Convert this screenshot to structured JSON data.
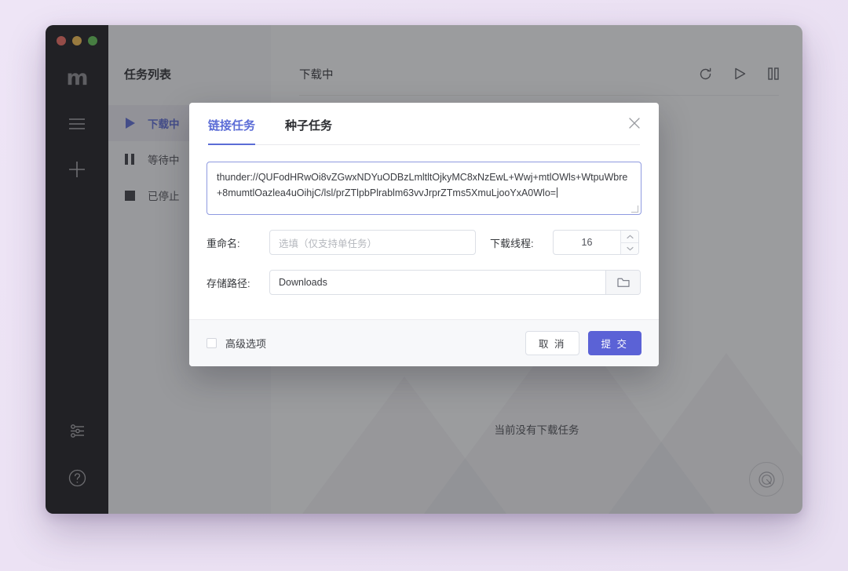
{
  "window": {
    "traffic_lights": [
      "close",
      "minimize",
      "maximize"
    ],
    "logo": "m"
  },
  "rail": {
    "items": [
      {
        "name": "menu",
        "icon": "hamburger-menu-icon"
      },
      {
        "name": "add",
        "icon": "plus-icon"
      }
    ],
    "bottom_items": [
      {
        "name": "preferences",
        "icon": "sliders-icon"
      },
      {
        "name": "help",
        "icon": "question-circle-icon"
      }
    ]
  },
  "tasklist": {
    "title": "任务列表",
    "items": [
      {
        "label": "下载中",
        "icon": "play-icon",
        "active": true
      },
      {
        "label": "等待中",
        "icon": "pause-icon",
        "active": false
      },
      {
        "label": "已停止",
        "icon": "stop-icon",
        "active": false
      }
    ]
  },
  "main": {
    "title": "下载中",
    "actions": [
      {
        "name": "refresh",
        "icon": "refresh-icon"
      },
      {
        "name": "resume-all",
        "icon": "play-icon"
      },
      {
        "name": "pause-all",
        "icon": "pause-icon"
      }
    ],
    "empty_text": "当前没有下载任务",
    "speed_badge": "speedometer-icon"
  },
  "dialog": {
    "tabs": [
      {
        "label": "链接任务",
        "active": true
      },
      {
        "label": "种子任务",
        "active": false
      }
    ],
    "close_icon": "close-icon",
    "url_value": "thunder://QUFodHRwOi8vZGwxNDYuODBzLmltltOjkyMC8xNzEwL+Wwj+mtlOWls+WtpuWbre+8mumtlOazlea4uOihjC/lsl/prZTlpbPlrablm63vvJrprZTms5XmuLjooYxA0Wlo=",
    "rename": {
      "label": "重命名:",
      "value": "",
      "placeholder": "选填（仅支持单任务）"
    },
    "threads": {
      "label": "下载线程:",
      "value": "16"
    },
    "path": {
      "label": "存储路径:",
      "value": "Downloads",
      "browse_icon": "folder-icon"
    },
    "advanced": {
      "label": "高级选项",
      "checked": false
    },
    "cancel_label": "取 消",
    "submit_label": "提 交",
    "accent_color": "#5b62d6"
  }
}
